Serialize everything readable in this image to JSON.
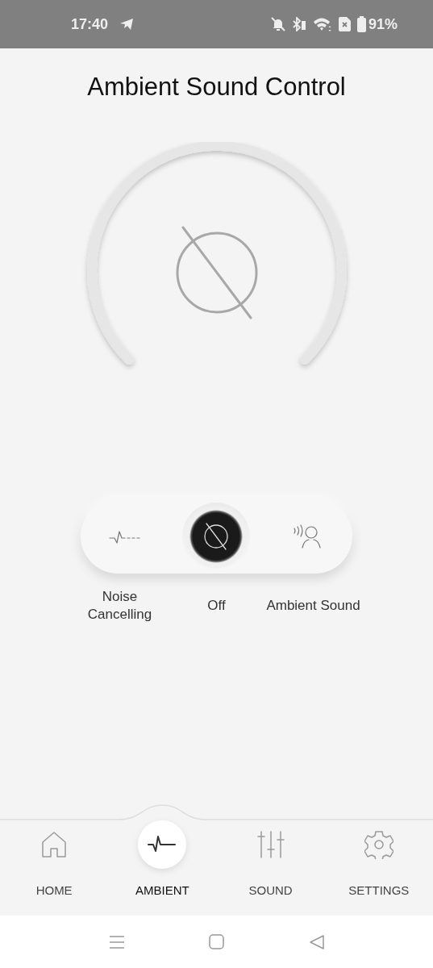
{
  "status_bar": {
    "time": "17:40",
    "battery": "91%"
  },
  "title": "Ambient Sound Control",
  "modes": [
    {
      "label": "Noise Cancelling",
      "kind": "noise",
      "selected": false
    },
    {
      "label": "Off",
      "kind": "off",
      "selected": true
    },
    {
      "label": "Ambient Sound",
      "kind": "ambient",
      "selected": false
    }
  ],
  "nav": [
    {
      "label": "HOME",
      "kind": "home",
      "selected": false
    },
    {
      "label": "AMBIENT",
      "kind": "ambient",
      "selected": true
    },
    {
      "label": "SOUND",
      "kind": "sound",
      "selected": false
    },
    {
      "label": "SETTINGS",
      "kind": "settings",
      "selected": false
    }
  ]
}
